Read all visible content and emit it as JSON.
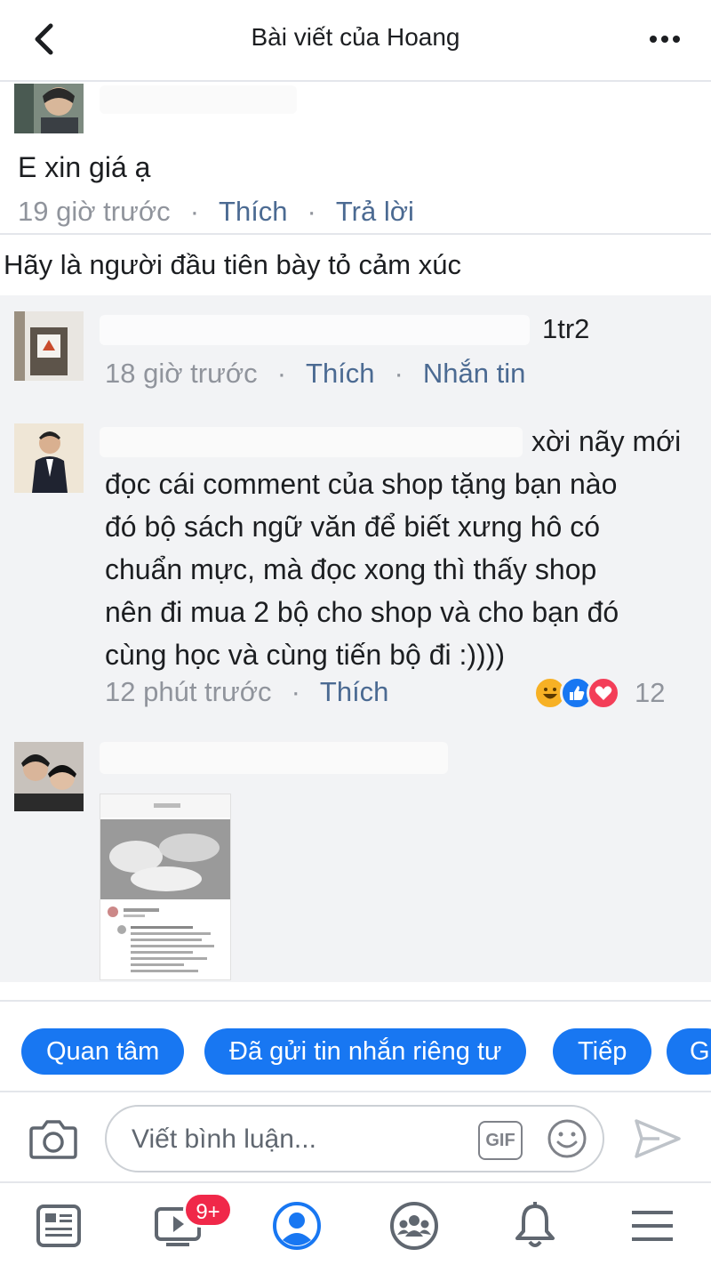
{
  "header": {
    "title": "Bài viết của Hoang"
  },
  "comment_1": {
    "text": "E xin giá ạ",
    "time": "19 giờ trước",
    "like": "Thích",
    "reply": "Trả lời"
  },
  "reaction_prompt": "Hãy là người đầu tiên bày tỏ cảm xúc",
  "reply_1": {
    "text": "1tr2",
    "time": "18 giờ trước",
    "like": "Thích",
    "message": "Nhắn tin"
  },
  "reply_2": {
    "line1": "xời nãy mới",
    "lines": [
      "đọc cái comment của shop tặng bạn nào",
      "đó bộ sách ngữ văn để biết xưng hô có",
      "chuẩn mực, mà đọc xong thì thấy shop",
      "nên đi mua 2 bộ cho shop và cho bạn đó",
      "cùng học và cùng tiến bộ đi :))))"
    ],
    "time": "12 phút trước",
    "like": "Thích",
    "reaction_count": "12",
    "reactions": [
      "haha-icon",
      "like-icon",
      "love-icon"
    ]
  },
  "quick_replies": [
    "Quan tâm",
    "Đã gửi tin nhắn riêng tư",
    "Tiếp",
    "G"
  ],
  "composer": {
    "placeholder": "Viết bình luận...",
    "gif_label": "GIF"
  },
  "nav": {
    "badge": "9+"
  },
  "colors": {
    "accent": "#1877f2",
    "link": "#4b6a92",
    "meta": "#90949c",
    "badge": "#f02849"
  }
}
